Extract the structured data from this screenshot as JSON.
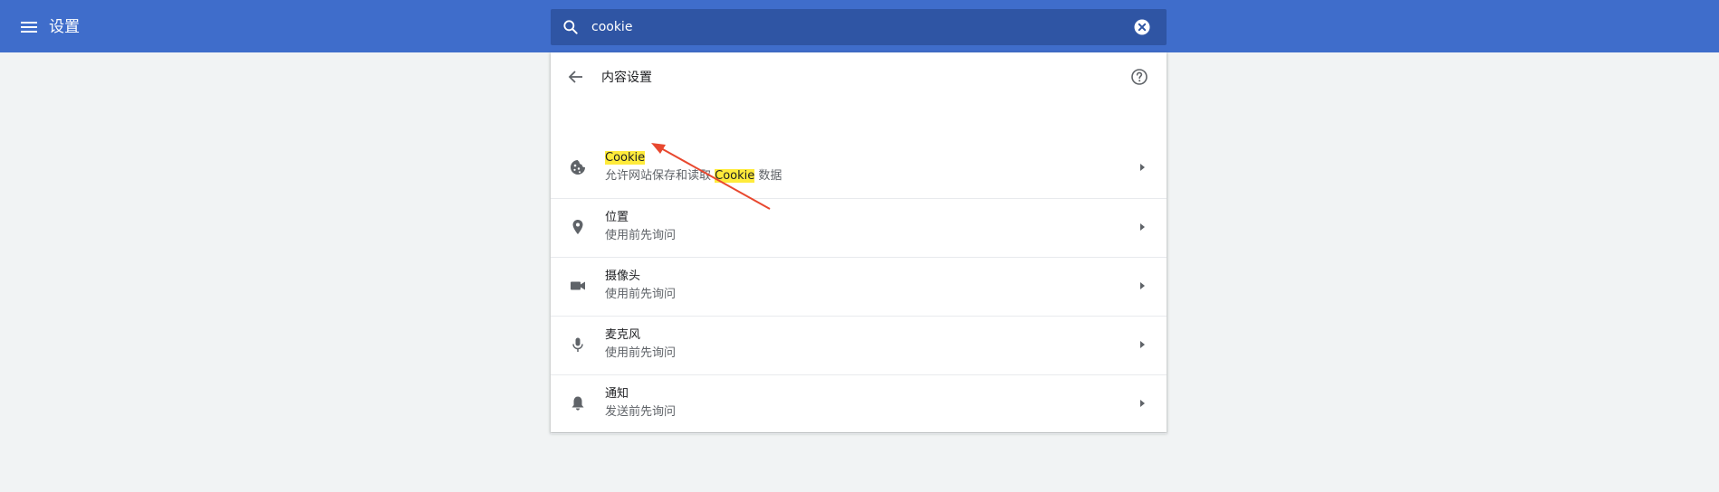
{
  "header": {
    "menu_icon": "hamburger-menu-icon",
    "title": "设置"
  },
  "search": {
    "icon": "search-icon",
    "value": "cookie",
    "clear_icon": "clear-circle-icon"
  },
  "content_settings": {
    "back_icon": "arrow-back-icon",
    "title": "内容设置",
    "help_icon": "help-circle-icon",
    "items": [
      {
        "icon": "cookie-icon",
        "title": "Cookie",
        "title_highlighted": true,
        "subtitle_before": "允许网站保存和读取 ",
        "subtitle_highlight": "Cookie",
        "subtitle_after": " 数据"
      },
      {
        "icon": "location-pin-icon",
        "title": "位置",
        "subtitle": "使用前先询问"
      },
      {
        "icon": "camera-icon",
        "title": "摄像头",
        "subtitle": "使用前先询问"
      },
      {
        "icon": "microphone-icon",
        "title": "麦克风",
        "subtitle": "使用前先询问"
      },
      {
        "icon": "bell-icon",
        "title": "通知",
        "subtitle": "发送前先询问"
      }
    ]
  },
  "colors": {
    "topbar": "#3f6dcb",
    "searchbox": "#2f55a4",
    "highlight": "#ffeb3b",
    "annotation_arrow": "#e8482f",
    "icon": "#5f6368"
  }
}
